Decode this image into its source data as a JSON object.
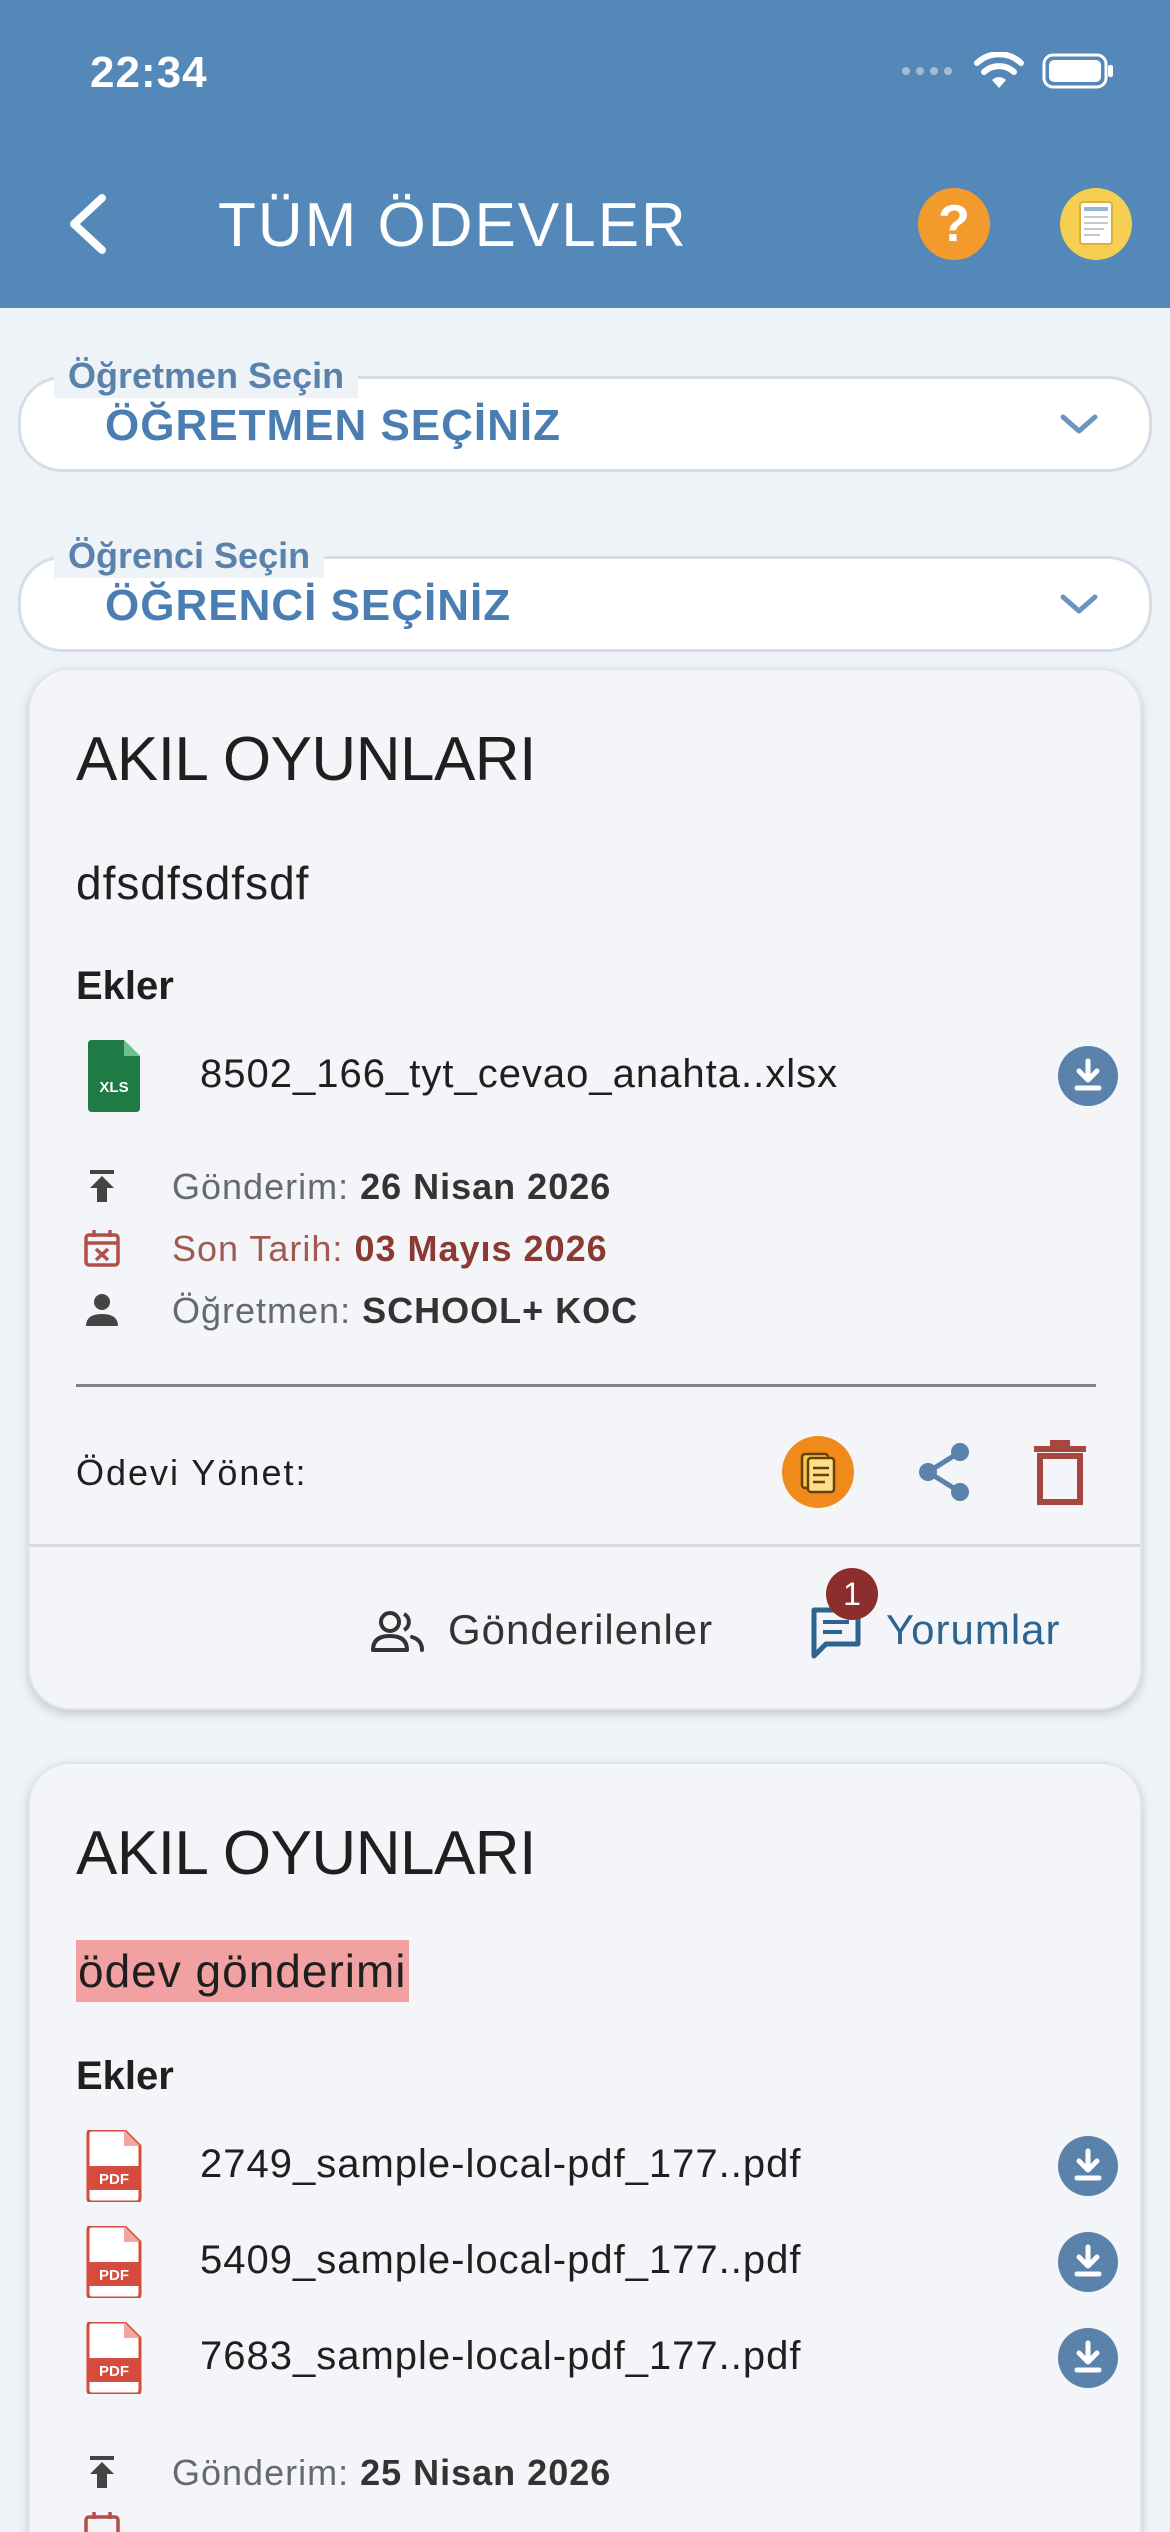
{
  "status_bar": {
    "time": "22:34"
  },
  "header": {
    "title": "TÜM ÖDEVLER",
    "help_symbol": "?"
  },
  "filters": {
    "teacher": {
      "label": "Öğretmen Seçin",
      "value": "ÖĞRETMEN SEÇİNİZ"
    },
    "student": {
      "label": "Öğrenci Seçin",
      "value": "ÖĞRENCİ SEÇİNİZ"
    }
  },
  "assignments": [
    {
      "title": "AKIL OYUNLARI",
      "description": "dfsdfsdfsdf",
      "attachments_heading": "Ekler",
      "attachments": [
        {
          "name": "8502_166_tyt_cevao_anahta..xlsx",
          "type_label": "XLS",
          "icon": "xls-file-icon"
        }
      ],
      "sent_label": "Gönderim:",
      "sent_date": "26 Nisan 2026",
      "due_label": "Son Tarih:",
      "due_date": "03 Mayıs 2026",
      "teacher_label": "Öğretmen:",
      "teacher_name": "SCHOOL+ KOC",
      "manage_label": "Ödevi Yönet:",
      "submissions_label": "Gönderilenler",
      "comments_label": "Yorumlar",
      "comments_count": "1"
    },
    {
      "title": "AKIL OYUNLARI",
      "description": "ödev gönderimi",
      "attachments_heading": "Ekler",
      "attachments": [
        {
          "name": "2749_sample-local-pdf_177..pdf",
          "type_label": "PDF",
          "icon": "pdf-file-icon"
        },
        {
          "name": "5409_sample-local-pdf_177..pdf",
          "type_label": "PDF",
          "icon": "pdf-file-icon"
        },
        {
          "name": "7683_sample-local-pdf_177..pdf",
          "type_label": "PDF",
          "icon": "pdf-file-icon"
        }
      ],
      "sent_label": "Gönderim:",
      "sent_date": "25 Nisan 2026"
    }
  ],
  "colors": {
    "header_bg": "#5388b8",
    "page_bg": "#eef3f8",
    "accent_blue": "#4a7db2",
    "help_orange": "#f39a2c",
    "due_red": "#8a3a32",
    "badge_red": "#8c2f2c",
    "highlight_pink": "#f2a1a3"
  }
}
